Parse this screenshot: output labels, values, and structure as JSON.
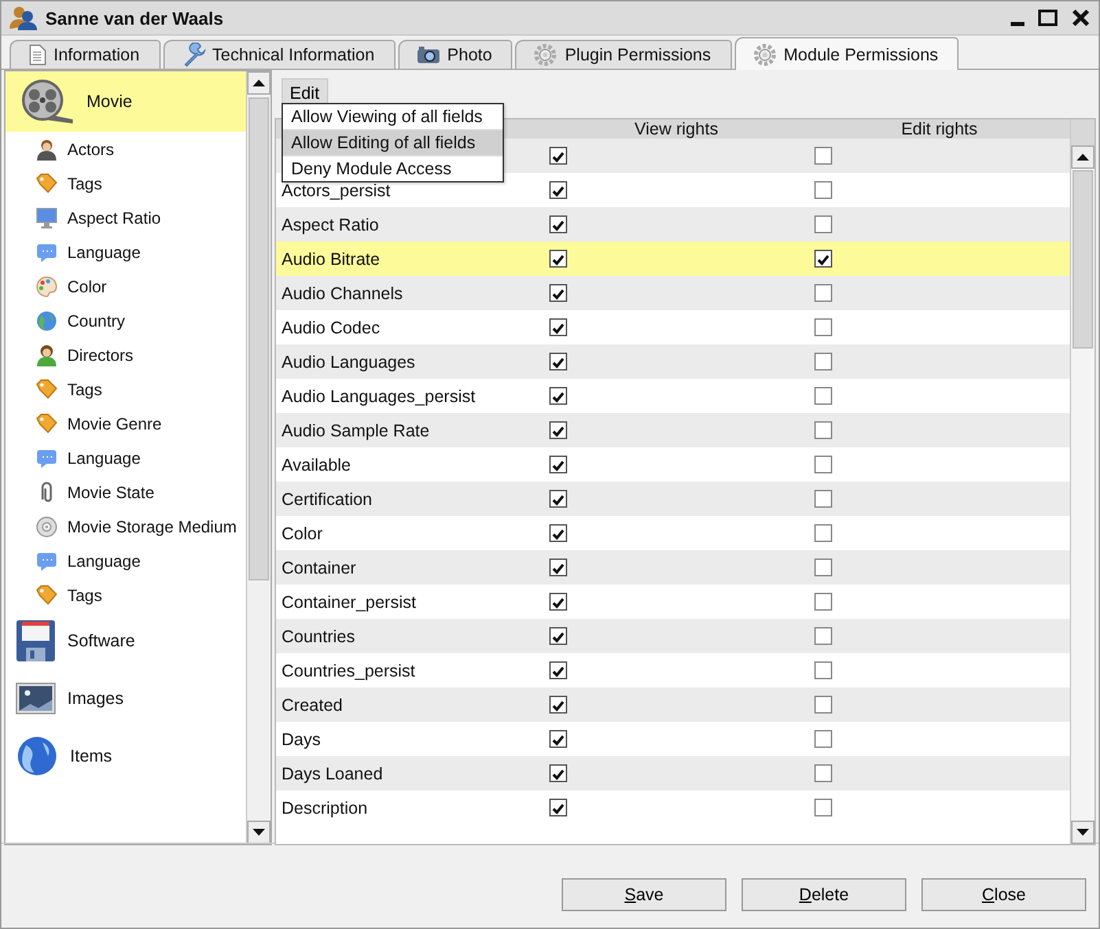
{
  "window": {
    "title": "Sanne van der Waals"
  },
  "tabs": [
    {
      "label": "Information",
      "kind": "page",
      "selected": false
    },
    {
      "label": "Technical Information",
      "kind": "wrench",
      "selected": false
    },
    {
      "label": "Photo",
      "kind": "camera",
      "selected": false
    },
    {
      "label": "Plugin Permissions",
      "kind": "gear",
      "selected": false
    },
    {
      "label": "Module Permissions",
      "kind": "gear",
      "selected": true
    }
  ],
  "sidebar": {
    "items": [
      {
        "label": "Movie",
        "kind": "film",
        "selected": true,
        "children": [
          {
            "label": "Actors",
            "kind": "person"
          },
          {
            "label": "Tags",
            "kind": "tag"
          },
          {
            "label": "Aspect Ratio",
            "kind": "monitor"
          },
          {
            "label": "Language",
            "kind": "speech"
          },
          {
            "label": "Color",
            "kind": "palette"
          },
          {
            "label": "Country",
            "kind": "globe"
          },
          {
            "label": "Directors",
            "kind": "person2"
          },
          {
            "label": "Tags",
            "kind": "tag"
          },
          {
            "label": "Movie Genre",
            "kind": "tag"
          },
          {
            "label": "Language",
            "kind": "speech"
          },
          {
            "label": "Movie State",
            "kind": "clip"
          },
          {
            "label": "Movie Storage Medium",
            "kind": "disc"
          },
          {
            "label": "Language",
            "kind": "speech"
          },
          {
            "label": "Tags",
            "kind": "tag"
          }
        ]
      },
      {
        "label": "Software",
        "kind": "floppy",
        "selected": false
      },
      {
        "label": "Images",
        "kind": "image",
        "selected": false
      },
      {
        "label": "Items",
        "kind": "globe",
        "selected": false
      }
    ]
  },
  "toolbar": {
    "menu_button": "Edit",
    "menu": [
      {
        "label": "Allow Viewing of all fields",
        "selected": false
      },
      {
        "label": "Allow Editing of all fields",
        "selected": true
      },
      {
        "label": "Deny Module Access",
        "selected": false
      }
    ]
  },
  "table": {
    "columns": [
      "View rights",
      "Edit rights"
    ],
    "rows": [
      {
        "field": "",
        "view": true,
        "edit": false,
        "selected": false
      },
      {
        "field": "Actors_persist",
        "view": true,
        "edit": false,
        "selected": false
      },
      {
        "field": "Aspect Ratio",
        "view": true,
        "edit": false,
        "selected": false
      },
      {
        "field": "Audio Bitrate",
        "view": true,
        "edit": true,
        "selected": true
      },
      {
        "field": "Audio Channels",
        "view": true,
        "edit": false,
        "selected": false
      },
      {
        "field": "Audio Codec",
        "view": true,
        "edit": false,
        "selected": false
      },
      {
        "field": "Audio Languages",
        "view": true,
        "edit": false,
        "selected": false
      },
      {
        "field": "Audio Languages_persist",
        "view": true,
        "edit": false,
        "selected": false
      },
      {
        "field": "Audio Sample Rate",
        "view": true,
        "edit": false,
        "selected": false
      },
      {
        "field": "Available",
        "view": true,
        "edit": false,
        "selected": false
      },
      {
        "field": "Certification",
        "view": true,
        "edit": false,
        "selected": false
      },
      {
        "field": "Color",
        "view": true,
        "edit": false,
        "selected": false
      },
      {
        "field": "Container",
        "view": true,
        "edit": false,
        "selected": false
      },
      {
        "field": "Container_persist",
        "view": true,
        "edit": false,
        "selected": false
      },
      {
        "field": "Countries",
        "view": true,
        "edit": false,
        "selected": false
      },
      {
        "field": "Countries_persist",
        "view": true,
        "edit": false,
        "selected": false
      },
      {
        "field": "Created",
        "view": true,
        "edit": false,
        "selected": false
      },
      {
        "field": "Days",
        "view": true,
        "edit": false,
        "selected": false
      },
      {
        "field": "Days Loaned",
        "view": true,
        "edit": false,
        "selected": false
      },
      {
        "field": "Description",
        "view": true,
        "edit": false,
        "selected": false
      }
    ]
  },
  "buttons": [
    "Save",
    "Delete",
    "Close"
  ]
}
